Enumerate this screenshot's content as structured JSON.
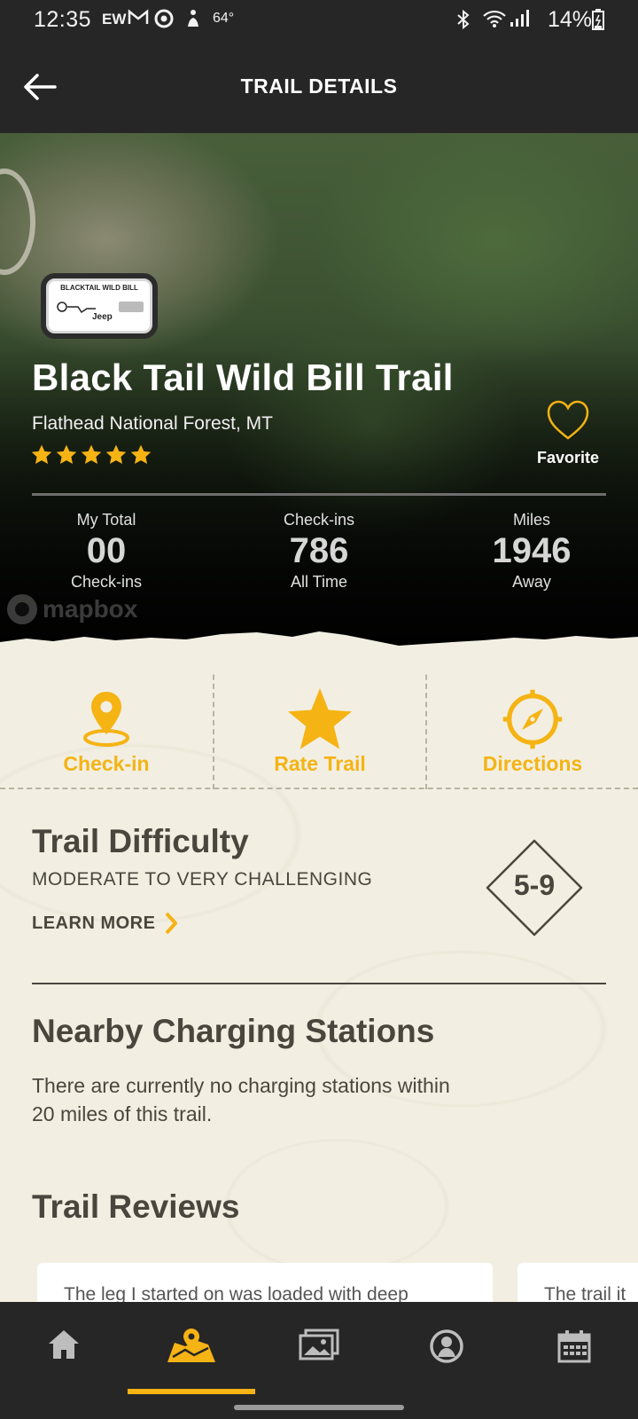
{
  "status_bar": {
    "time": "12:35",
    "carrier_badge": "EW",
    "temperature": "64°",
    "battery": "14%"
  },
  "header": {
    "title": "TRAIL DETAILS"
  },
  "trail": {
    "badge_name": "BLACKTAIL WILD BILL",
    "badge_brand": "Jeep",
    "name": "Black Tail Wild Bill Trail",
    "location": "Flathead National Forest, MT",
    "rating": 5,
    "favorite_label": "Favorite"
  },
  "stats": [
    {
      "top": "My Total",
      "value": "00",
      "bottom": "Check-ins"
    },
    {
      "top": "Check-ins",
      "value": "786",
      "bottom": "All Time"
    },
    {
      "top": "Miles",
      "value": "1946",
      "bottom": "Away"
    }
  ],
  "map_attribution": "mapbox",
  "actions": [
    {
      "label": "Check-in",
      "icon": "map-pin-icon"
    },
    {
      "label": "Rate Trail",
      "icon": "star-icon"
    },
    {
      "label": "Directions",
      "icon": "compass-icon"
    }
  ],
  "difficulty": {
    "title": "Trail Difficulty",
    "level": "MODERATE TO VERY CHALLENGING",
    "learn_more": "LEARN MORE",
    "rating": "5-9"
  },
  "charging": {
    "title": "Nearby Charging Stations",
    "text": "There are currently no charging stations within 20 miles of this trail."
  },
  "reviews": {
    "title": "Trail Reviews",
    "items": [
      "The leg I started on was loaded with deep",
      "The trail it"
    ]
  },
  "nav": [
    {
      "name": "home",
      "icon": "home-icon"
    },
    {
      "name": "trails",
      "icon": "trail-map-icon",
      "active": true
    },
    {
      "name": "gallery",
      "icon": "photo-gallery-icon"
    },
    {
      "name": "profile",
      "icon": "profile-icon"
    },
    {
      "name": "calendar",
      "icon": "calendar-icon"
    }
  ],
  "colors": {
    "accent": "#f5b314",
    "header_bg": "#262626",
    "content_bg": "#f2efe2",
    "text_dark": "#4a463e"
  }
}
